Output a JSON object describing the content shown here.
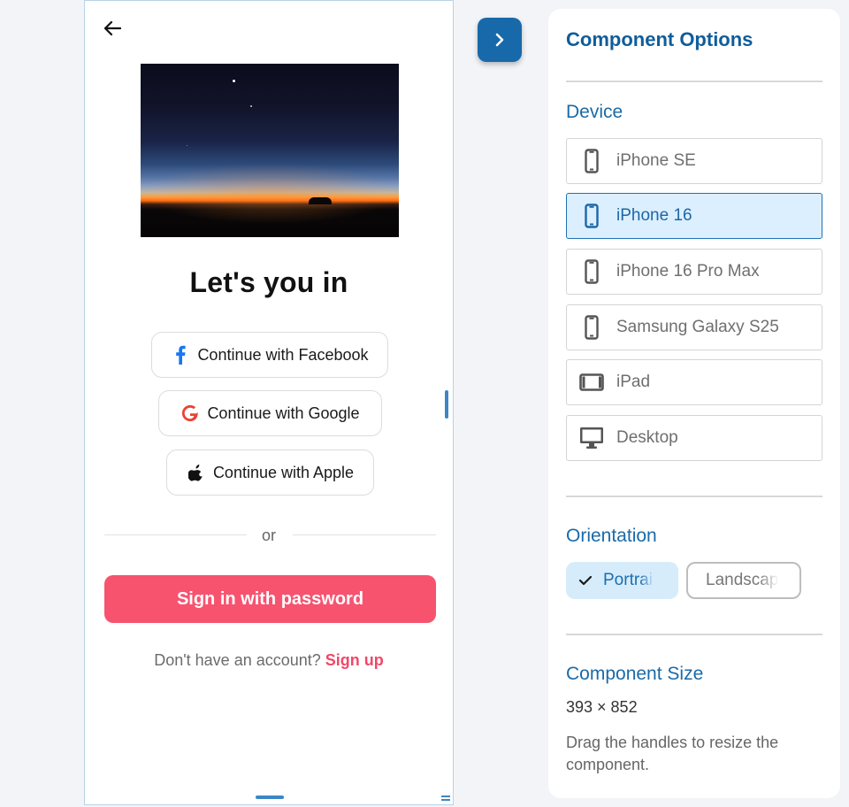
{
  "login": {
    "title": "Let's you in",
    "facebook_label": "Continue with Facebook",
    "google_label": "Continue with Google",
    "apple_label": "Continue with Apple",
    "or_label": "or",
    "password_button": "Sign in with password",
    "no_account_text": "Don't have an account? ",
    "signup_link": "Sign up"
  },
  "panel": {
    "title": "Component Options",
    "device_label": "Device",
    "devices": [
      {
        "label": "iPhone SE",
        "icon": "phone-icon",
        "selected": false
      },
      {
        "label": "iPhone 16",
        "icon": "phone-icon",
        "selected": true
      },
      {
        "label": "iPhone 16 Pro Max",
        "icon": "phone-icon",
        "selected": false
      },
      {
        "label": "Samsung Galaxy S25",
        "icon": "phone-icon",
        "selected": false
      },
      {
        "label": "iPad",
        "icon": "tablet-icon",
        "selected": false
      },
      {
        "label": "Desktop",
        "icon": "desktop-icon",
        "selected": false
      }
    ],
    "orientation_label": "Orientation",
    "orientation_portrait": "Portrait",
    "orientation_landscape": "Landscape",
    "selected_orientation": "Portrait",
    "size_label": "Component Size",
    "size_value": "393 × 852",
    "size_hint": "Drag the handles to resize the component."
  },
  "colors": {
    "accent_blue": "#1769aa",
    "primary_pink": "#f7536f",
    "link_pink": "#f24768",
    "selected_device_bg": "#dcefff"
  }
}
